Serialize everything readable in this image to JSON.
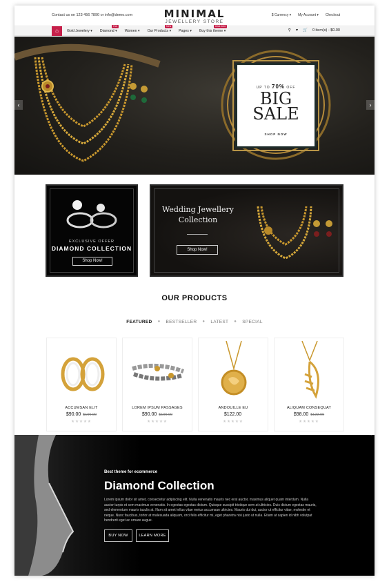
{
  "header": {
    "contact": "Contact us on 123 456 7890 or info@demo.com",
    "logo_title": "MINIMAL",
    "logo_sub": "JEWELLERY STORE",
    "currency": "$ Currency",
    "account": "My Account",
    "checkout": "Checkout"
  },
  "nav": {
    "items": [
      {
        "label": "Gold Jewelery ▾"
      },
      {
        "label": "Diamond ▾",
        "badge": "Hot",
        "badge_color": "#c6204a"
      },
      {
        "label": "Women ▾"
      },
      {
        "label": "Our Products ▾",
        "badge": "New",
        "badge_color": "#c6204a"
      },
      {
        "label": "Pages ▾"
      },
      {
        "label": "Buy this theme ▾",
        "badge": "Click here",
        "badge_color": "#c6204a"
      }
    ],
    "cart": "0 item(s) - $0.00"
  },
  "hero": {
    "up_to": "UP TO",
    "percent": "70%",
    "off": "OFF",
    "big": "BIG",
    "sale": "SALE",
    "shop_now": "SHOP NOW"
  },
  "banners": {
    "left": {
      "offer": "EXCLUSIVE OFFER",
      "title": "DIAMOND COLLECTION",
      "button": "Shop Now!"
    },
    "right": {
      "title_line1": "Wedding Jewellery",
      "title_line2": "Collection",
      "button": "Shop Now!"
    }
  },
  "products_section": {
    "title": "OUR PRODUCTS",
    "tabs": [
      "FEATURED",
      "BESTSELLER",
      "LATEST",
      "SPECIAL"
    ],
    "items": [
      {
        "name": "ACCUMSAN ELIT",
        "price": "$90.00",
        "old_price": "$100.00"
      },
      {
        "name": "LOREM IPSUM PASSAGES",
        "price": "$90.00",
        "old_price": "$100.00"
      },
      {
        "name": "ANDOUILLE EU",
        "price": "$122.00",
        "old_price": ""
      },
      {
        "name": "ALIQUAM CONSEQUAT",
        "price": "$98.00",
        "old_price": "$122.00"
      }
    ]
  },
  "diamond": {
    "subtitle": "Best theme for ecommerce",
    "title": "Diamond Collection",
    "text": "Lorem ipsum dolor sit amet, consectetur adipiscing elit. Nulla venenatis mauris nec erat auctor, maximus aliquet quam interdum. Nulla auctor turpis et sem maximus venenatis. In egestas egestas dictum. Quisque suscipit tristique sem at ultricies. Duis dictum egestas mauris, sed elementum mauris iaculis at. Nam sit amet tellus vitae metus accumsan ultricies. Mauris dui dui, auctor ut efficitur vitae, molestie et neque. Nunc faucibus, tortor at malesuada aliquam, orci felis efficitur mi, eget pharetra nisi justo ut nulla. Etiam at sapien id nibh volutpat hendrerit eget ac ornare augue.",
    "buy_now": "BUY NOW",
    "learn_more": "LEARN MORE"
  }
}
